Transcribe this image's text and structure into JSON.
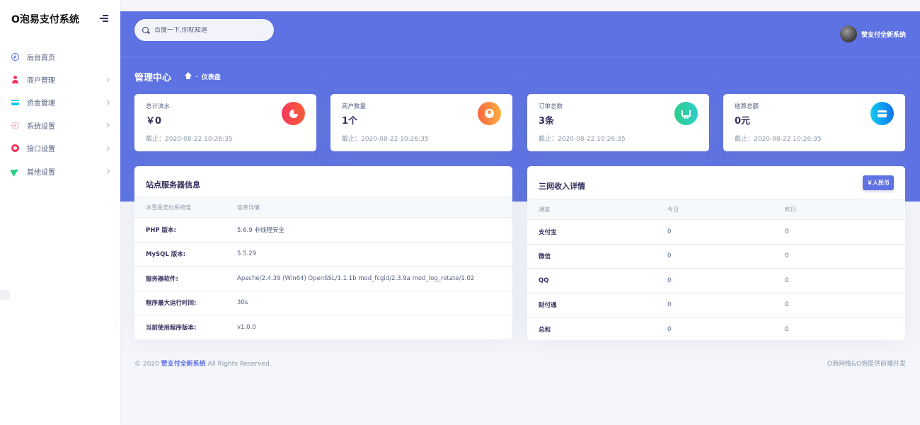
{
  "app": {
    "brand": "O泡易支付系统"
  },
  "sidebar": {
    "items": [
      {
        "label": "后台首页",
        "icon": "compass-icon"
      },
      {
        "label": "商户管理",
        "icon": "user-icon"
      },
      {
        "label": "资金管理",
        "icon": "credit-card-icon"
      },
      {
        "label": "系统设置",
        "icon": "gear-icon"
      },
      {
        "label": "接口设置",
        "icon": "plug-icon"
      },
      {
        "label": "其他设置",
        "icon": "send-icon"
      }
    ]
  },
  "header": {
    "search_placeholder": "百度一下,你就知道",
    "user_name": "赞支付全新系统",
    "page_title": "管理中心",
    "breadcrumb_sep": "-",
    "breadcrumb_current": "仪表盘",
    "accent_color": "#5e72e4"
  },
  "stats": [
    {
      "label": "总计流水",
      "value": "￥0",
      "timestamp": "截止：2020-08-22 10:26:35",
      "icon": "pie-chart-icon"
    },
    {
      "label": "商户数量",
      "value": "1个",
      "timestamp": "截止：2020-08-22 10:26:35",
      "icon": "user-circle-icon"
    },
    {
      "label": "订单总数",
      "value": "3条",
      "timestamp": "截止：2020-08-22 10:26:35",
      "icon": "cart-icon"
    },
    {
      "label": "结算总额",
      "value": "0元",
      "timestamp": "截止：2020-08-22 10:26:35",
      "icon": "wallet-icon"
    }
  ],
  "server_info": {
    "title": "站点服务器信息",
    "columns": [
      "冰雪易支付系统哇",
      "信息详情"
    ],
    "rows": [
      [
        "PHP 版本:",
        "5.6.9 非线程安全"
      ],
      [
        "MySQL 版本:",
        "5.5.29"
      ],
      [
        "服务器软件:",
        "Apache/2.4.39 (Win64) OpenSSL/1.1.1b mod_fcgid/2.3.9a mod_log_rotate/1.02"
      ],
      [
        "程序最大运行时间:",
        "30s"
      ],
      [
        "当前使用程序版本:",
        "v1.0.0"
      ]
    ]
  },
  "income": {
    "title": "三网收入详情",
    "currency_button": "￥人民币",
    "columns": [
      "通道",
      "今日",
      "昨日"
    ],
    "rows": [
      [
        "支付宝",
        "0",
        "0"
      ],
      [
        "微信",
        "0",
        "0"
      ],
      [
        "QQ",
        "0",
        "0"
      ],
      [
        "财付通",
        "0",
        "0"
      ],
      [
        "总和",
        "0",
        "0"
      ]
    ]
  },
  "footer": {
    "copyright_prefix": "© 2020",
    "brand_link": "赞支付全新系统",
    "copyright_suffix": "All Rights Reserved.",
    "right_text": "O泡网络&O泡提供前端开发"
  }
}
